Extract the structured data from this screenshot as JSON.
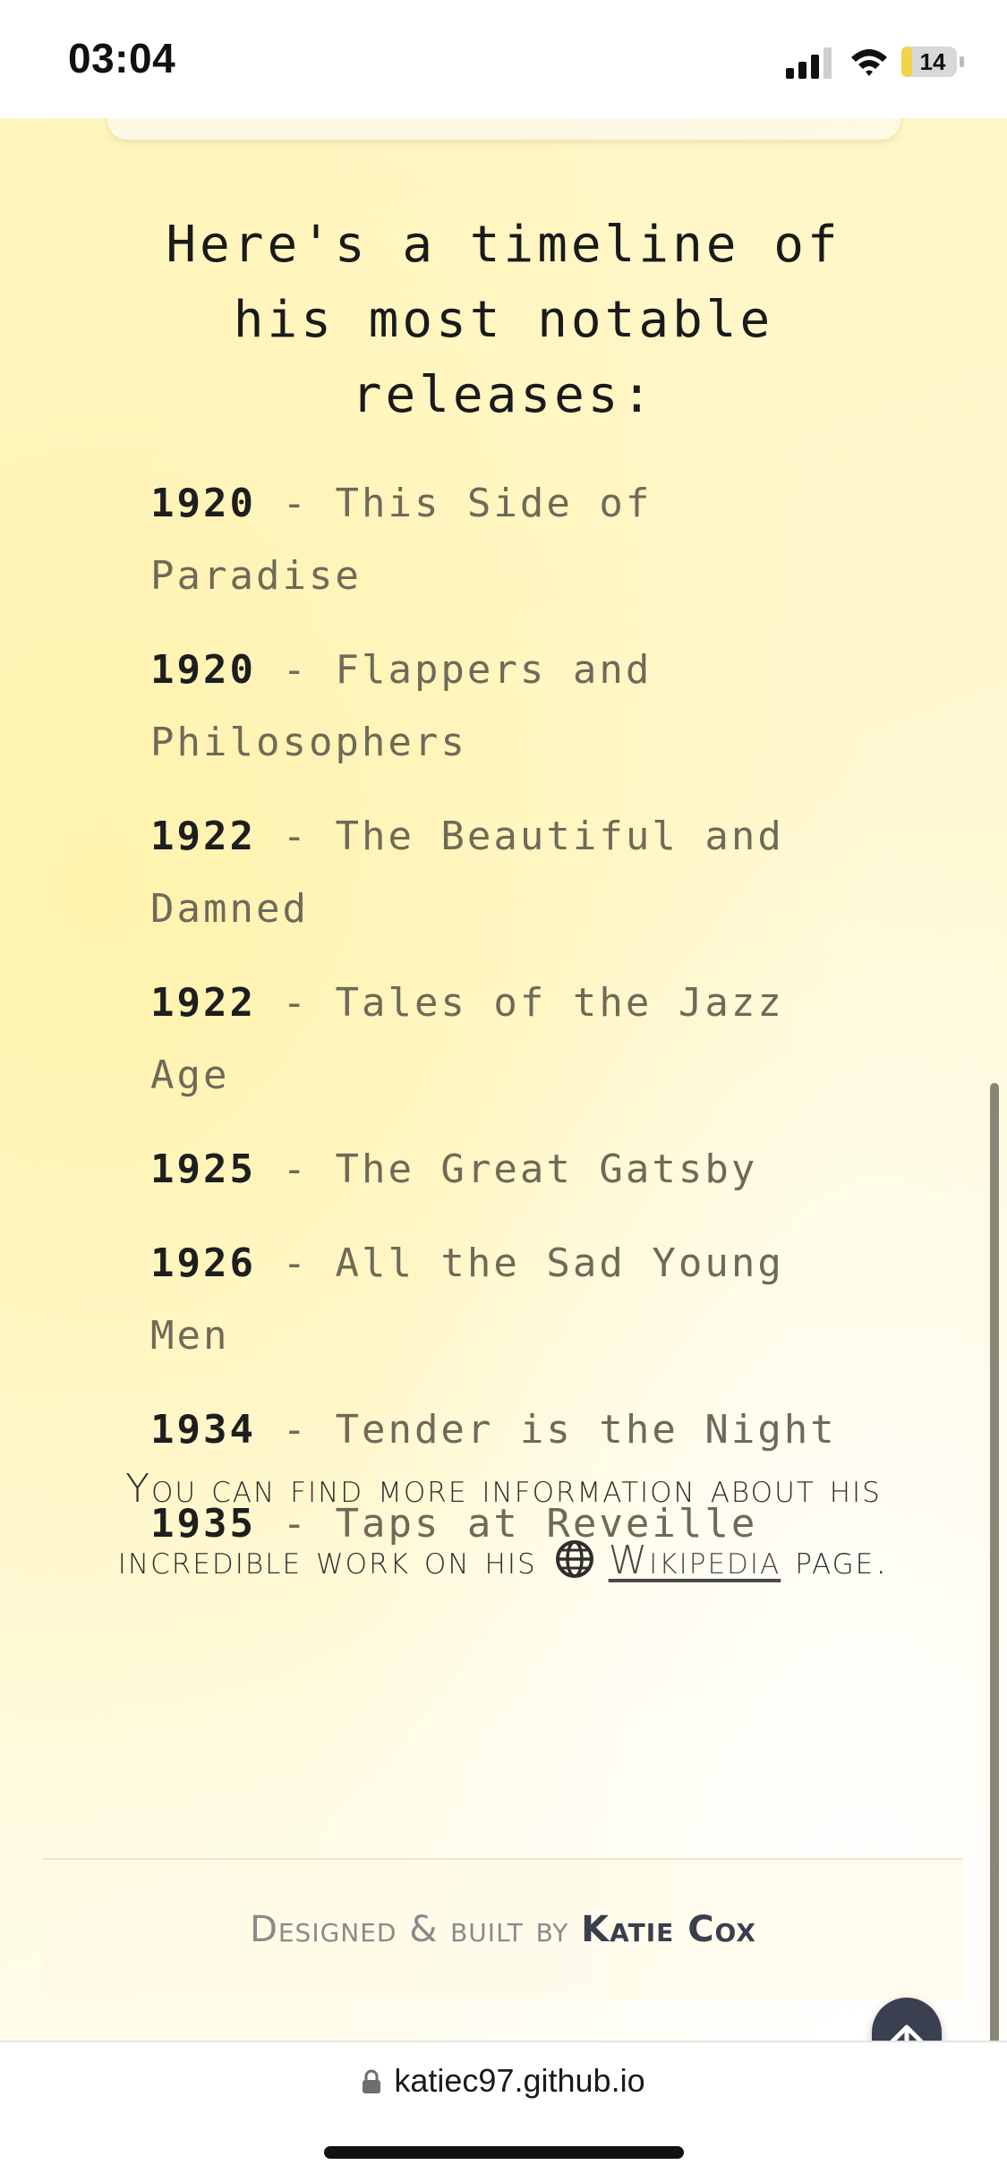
{
  "status_bar": {
    "time": "03:04",
    "battery_level": "14",
    "icons": [
      "signal-icon",
      "wifi-icon",
      "battery-charging-icon"
    ]
  },
  "main": {
    "timeline_heading": "Here's a timeline of his most notable releases:",
    "releases": [
      {
        "year": "1920",
        "title": "This Side of Paradise"
      },
      {
        "year": "1920",
        "title": "Flappers and Philosophers"
      },
      {
        "year": "1922",
        "title": "The Beautiful and Damned"
      },
      {
        "year": "1922",
        "title": "Tales of the Jazz Age"
      },
      {
        "year": "1925",
        "title": "The Great Gatsby"
      },
      {
        "year": "1926",
        "title": "All the Sad Young Men"
      },
      {
        "year": "1934",
        "title": "Tender is the Night"
      },
      {
        "year": "1935",
        "title": "Taps at Reveille"
      }
    ],
    "separator": "-",
    "info_prefix": "You can find more information about his incredible work on his",
    "wiki_link_label": "Wikipedia",
    "info_suffix": "page."
  },
  "footer": {
    "designed_by": "Designed & built by",
    "author": "Katie Cox"
  },
  "browser": {
    "url": "katiec97.github.io"
  },
  "colors": {
    "background_yellow": "#fff6c2",
    "heading_text": "#1a1a1a",
    "year_text": "#1e1e1e",
    "title_text": "#6f6a58",
    "button_dark": "#3b4050"
  }
}
